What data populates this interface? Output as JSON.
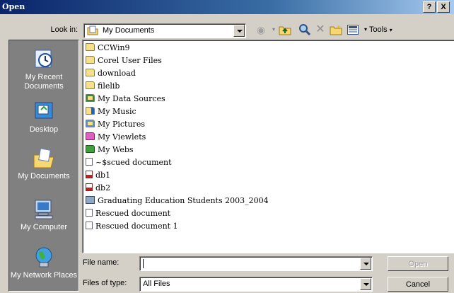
{
  "window": {
    "title": "Open",
    "help_btn": "?",
    "close_btn": "X"
  },
  "toolbar": {
    "lookin_label": "Look in:",
    "lookin_value": "My Documents",
    "tools_label": "Tools"
  },
  "places": [
    {
      "label": "My Recent Documents",
      "icon": "recent-documents-icon"
    },
    {
      "label": "Desktop",
      "icon": "desktop-icon"
    },
    {
      "label": "My Documents",
      "icon": "my-documents-icon"
    },
    {
      "label": "My Computer",
      "icon": "my-computer-icon"
    },
    {
      "label": "My Network Places",
      "icon": "network-places-icon"
    }
  ],
  "files": [
    {
      "name": "CCWin9",
      "icon": "folder-icon"
    },
    {
      "name": "Corel User Files",
      "icon": "folder-icon"
    },
    {
      "name": "download",
      "icon": "folder-icon"
    },
    {
      "name": "filelib",
      "icon": "folder-icon"
    },
    {
      "name": "My Data Sources",
      "icon": "data-sources-folder-icon"
    },
    {
      "name": "My Music",
      "icon": "music-folder-icon"
    },
    {
      "name": "My Pictures",
      "icon": "pictures-folder-icon"
    },
    {
      "name": "My Viewlets",
      "icon": "viewlets-folder-icon"
    },
    {
      "name": "My Webs",
      "icon": "webs-folder-icon"
    },
    {
      "name": "~$scued document",
      "icon": "document-icon"
    },
    {
      "name": "db1",
      "icon": "access-db-icon"
    },
    {
      "name": "db2",
      "icon": "access-db-icon"
    },
    {
      "name": "Graduating Education Students 2003_2004",
      "icon": "application-icon"
    },
    {
      "name": "Rescued document",
      "icon": "document-icon"
    },
    {
      "name": "Rescued document 1",
      "icon": "document-icon"
    }
  ],
  "form": {
    "file_name_label": "File name:",
    "file_name_value": "",
    "file_type_label": "Files of type:",
    "file_type_value": "All Files"
  },
  "buttons": {
    "open": "Open",
    "cancel": "Cancel"
  }
}
